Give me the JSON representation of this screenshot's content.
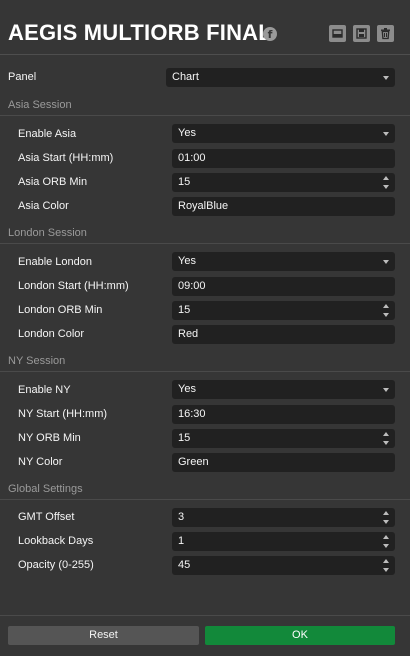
{
  "header": {
    "title": "AEGIS MULTIORB FINAL",
    "icons": [
      "facebook-icon",
      "minimize-icon",
      "save-icon",
      "trash-icon"
    ]
  },
  "panel": {
    "label": "Panel",
    "value": "Chart"
  },
  "sections": {
    "asia": {
      "title": "Asia Session",
      "enable_label": "Enable Asia",
      "enable_value": "Yes",
      "start_label": "Asia Start (HH:mm)",
      "start_value": "01:00",
      "orb_label": "Asia ORB Min",
      "orb_value": "15",
      "color_label": "Asia Color",
      "color_value": "RoyalBlue"
    },
    "london": {
      "title": "London Session",
      "enable_label": "Enable London",
      "enable_value": "Yes",
      "start_label": "London Start (HH:mm)",
      "start_value": "09:00",
      "orb_label": "London ORB Min",
      "orb_value": "15",
      "color_label": "London Color",
      "color_value": "Red"
    },
    "ny": {
      "title": "NY Session",
      "enable_label": "Enable NY",
      "enable_value": "Yes",
      "start_label": "NY Start (HH:mm)",
      "start_value": "16:30",
      "orb_label": "NY ORB Min",
      "orb_value": "15",
      "color_label": "NY Color",
      "color_value": "Green"
    },
    "global": {
      "title": "Global Settings",
      "gmt_label": "GMT Offset",
      "gmt_value": "3",
      "lookback_label": "Lookback Days",
      "lookback_value": "1",
      "opacity_label": "Opacity (0-255)",
      "opacity_value": "45"
    }
  },
  "footer": {
    "reset_label": "Reset",
    "ok_label": "OK"
  },
  "colors": {
    "background": "#363636",
    "field": "#212121",
    "ok": "#12893a",
    "reset": "#555555"
  }
}
